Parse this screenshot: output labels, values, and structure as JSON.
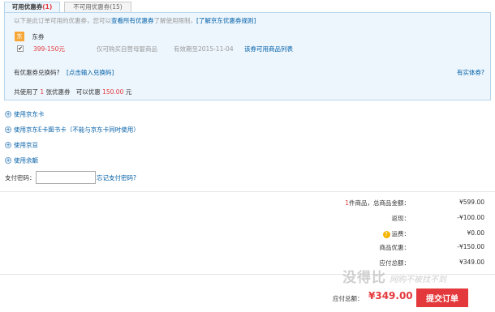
{
  "tabs": [
    {
      "label": "可用优惠券",
      "count": "(1)"
    },
    {
      "label": "不可用优惠券",
      "count": "(15)"
    }
  ],
  "hint": {
    "prefix": "以下是此订单可用的优惠券，您可以",
    "link1": "查看所有优惠券",
    "middle": "了解使用限制，",
    "link2": "[了解京东优惠券规则]"
  },
  "shop": {
    "badge": "东",
    "name": "东券"
  },
  "coupon": {
    "checked": "✔",
    "value": "399-150元",
    "limit": "仅可购买自营母婴商品",
    "expiry": "有效期至2015-11-04",
    "goods_link": "该券可用商品列表"
  },
  "code": {
    "label": "有优惠券兑换码?",
    "input_link": "[点击输入兑换码]",
    "entity_link": "有实体券?"
  },
  "used_summary": {
    "prefix": "共使用了",
    "count": "1",
    "middle": "张优惠券",
    "discount_prefix": "可以优惠",
    "amount": "150.00",
    "suffix": "元"
  },
  "options": [
    "使用京东卡",
    "使用京东E卡图书卡（不能与京东卡同时使用）",
    "使用京豆",
    "使用余额"
  ],
  "pay": {
    "label": "支付密码：",
    "value": "",
    "forgot": "忘记支付密码?"
  },
  "totals": [
    {
      "count": "1",
      "label": "件商品，总商品金额：",
      "value": "¥599.00"
    },
    {
      "label": "返现：",
      "value": "-¥100.00"
    },
    {
      "label": "运费：",
      "value": "¥0.00",
      "icon": "question-icon"
    },
    {
      "label": "商品优惠：",
      "value": "-¥150.00"
    },
    {
      "label": "应付总额：",
      "value": "¥349.00"
    }
  ],
  "footer": {
    "total_label": "应付总额：",
    "total_value": "¥349.00",
    "submit": "提交订单"
  },
  "watermark": {
    "big": "没得比",
    "small": "网购不被找不到"
  },
  "colors": {
    "accent": "#e4393c",
    "link": "#005ea7",
    "panel": "#edf6fd"
  }
}
